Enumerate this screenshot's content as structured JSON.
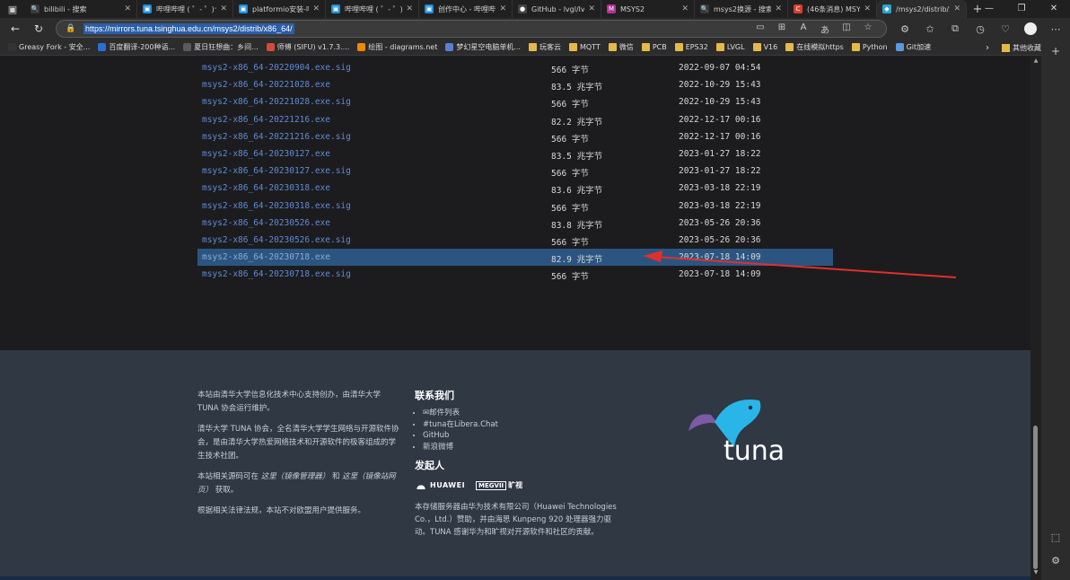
{
  "tabs": [
    {
      "label": "bilibili - 搜索",
      "icon": "search-icon",
      "color": "#3a3a3a",
      "glyph": "🔍"
    },
    {
      "label": "哔哩哔哩 ( ゜- ゜)つ",
      "icon": "bilibili-icon",
      "color": "#1f8ee0",
      "glyph": "▣"
    },
    {
      "label": "platformio安装-哔哩",
      "icon": "bilibili-icon",
      "color": "#1f8ee0",
      "glyph": "▣"
    },
    {
      "label": "哔哩哔哩 ( ゜- ゜)つ",
      "icon": "bilibili-icon",
      "color": "#1f8ee0",
      "glyph": "▣"
    },
    {
      "label": "创作中心 - 哔哩哔哩",
      "icon": "bilibili-icon",
      "color": "#1f8ee0",
      "glyph": "▣"
    },
    {
      "label": "GitHub - lvgl/lv_pla",
      "icon": "github-icon",
      "color": "#444444",
      "glyph": "●"
    },
    {
      "label": "MSYS2",
      "icon": "msys2-icon",
      "color": "#b4329a",
      "glyph": "M"
    },
    {
      "label": "msys2换源 - 搜索",
      "icon": "search-icon",
      "color": "#3a3a3a",
      "glyph": "🔍"
    },
    {
      "label": "(46条消息) MSYS2",
      "icon": "csdn-icon",
      "color": "#d9402b",
      "glyph": "C"
    },
    {
      "label": "/msys2/distrib/x86",
      "icon": "tuna-icon",
      "color": "#2ea3d8",
      "glyph": "◆"
    }
  ],
  "address": {
    "url": "https://mirrors.tuna.tsinghua.edu.cn/msys2/distrib/x86_64/"
  },
  "bookmarks": [
    {
      "label": "Greasy Fork - 安全...",
      "icon": "greasyfork-icon",
      "color": "#333333"
    },
    {
      "label": "百度翻译-200种语...",
      "icon": "baidu-translate-icon",
      "color": "#2a6ed8"
    },
    {
      "label": "夏日狂想曲：乡间...",
      "icon": "wordpress-icon",
      "color": "#5a5a5a"
    },
    {
      "label": "师傅 (SIFU) v1.7.3....",
      "icon": "site-icon",
      "color": "#d14b3a"
    },
    {
      "label": "绘图 - diagrams.net",
      "icon": "drawio-icon",
      "color": "#f08705"
    },
    {
      "label": "梦幻星空电脑单机...",
      "icon": "site-icon",
      "color": "#5b7fd1"
    },
    {
      "label": "玩客云",
      "icon": "folder-icon",
      "color": "#e6b84a"
    },
    {
      "label": "MQTT",
      "icon": "folder-icon",
      "color": "#e6b84a"
    },
    {
      "label": "微信",
      "icon": "folder-icon",
      "color": "#e6b84a"
    },
    {
      "label": "PCB",
      "icon": "folder-icon",
      "color": "#e6b84a"
    },
    {
      "label": "EPS32",
      "icon": "folder-icon",
      "color": "#e6b84a"
    },
    {
      "label": "LVGL",
      "icon": "folder-icon",
      "color": "#e6b84a"
    },
    {
      "label": "V16",
      "icon": "folder-icon",
      "color": "#e6b84a"
    },
    {
      "label": "在线模拟https",
      "icon": "folder-icon",
      "color": "#e6b84a"
    },
    {
      "label": "Python",
      "icon": "folder-icon",
      "color": "#e6b84a"
    },
    {
      "label": "Git加速",
      "icon": "git-icon",
      "color": "#5a9ae0"
    }
  ],
  "bookmarks_other": "其他收藏夹",
  "files": [
    {
      "name": "msys2-x86_64-20220904.exe.sig",
      "size": "566 字节",
      "date": "2022-09-07 04:54"
    },
    {
      "name": "msys2-x86_64-20221028.exe",
      "size": "83.5 兆字节",
      "date": "2022-10-29 15:43"
    },
    {
      "name": "msys2-x86_64-20221028.exe.sig",
      "size": "566 字节",
      "date": "2022-10-29 15:43"
    },
    {
      "name": "msys2-x86_64-20221216.exe",
      "size": "82.2 兆字节",
      "date": "2022-12-17 00:16"
    },
    {
      "name": "msys2-x86_64-20221216.exe.sig",
      "size": "566 字节",
      "date": "2022-12-17 00:16"
    },
    {
      "name": "msys2-x86_64-20230127.exe",
      "size": "83.5 兆字节",
      "date": "2023-01-27 18:22"
    },
    {
      "name": "msys2-x86_64-20230127.exe.sig",
      "size": "566 字节",
      "date": "2023-01-27 18:22"
    },
    {
      "name": "msys2-x86_64-20230318.exe",
      "size": "83.6 兆字节",
      "date": "2023-03-18 22:19"
    },
    {
      "name": "msys2-x86_64-20230318.exe.sig",
      "size": "566 字节",
      "date": "2023-03-18 22:19"
    },
    {
      "name": "msys2-x86_64-20230526.exe",
      "size": "83.8 兆字节",
      "date": "2023-05-26 20:36"
    },
    {
      "name": "msys2-x86_64-20230526.exe.sig",
      "size": "566 字节",
      "date": "2023-05-26 20:36"
    },
    {
      "name": "msys2-x86_64-20230718.exe",
      "size": "82.9 兆字节",
      "date": "2023-07-18 14:09",
      "selected": true
    },
    {
      "name": "msys2-x86_64-20230718.exe.sig",
      "size": "566 字节",
      "date": "2023-07-18 14:09"
    }
  ],
  "annotation": {
    "color": "#e0302c"
  },
  "footer": {
    "about": {
      "p1": "本站由清华大学信息化技术中心支持创办，由清华大学 TUNA 协会运行维护。",
      "p2": "清华大学 TUNA 协会，全名清华大学学生网络与开源软件协会，是由清华大学热爱网络技术和开源软件的极客组成的学生技术社团。",
      "p3_pre": "本站相关源码可在",
      "p3_link1": "这里（镜像管理器）",
      "p3_mid": "和",
      "p3_link2": "这里（镜像站网页）",
      "p3_post": "获取。",
      "p4": "根据相关法律法规，本站不对欧盟用户提供服务。"
    },
    "contact_title": "联系我们",
    "contact_items": [
      "✉邮件列表",
      "#tuna在Libera.Chat",
      "GitHub",
      "新浪微博"
    ],
    "sponsor_title": "发起人",
    "sponsor_huawei": "HUAWEI",
    "sponsor_megvii_box": "MEGVII",
    "sponsor_megvii_text": "旷视",
    "sponsor_desc": "本存储服务器由华为技术有限公司（Huawei Technologies Co.，Ltd.）赞助，并由海思 Kunpeng 920 处理器强力驱动。TUNA 感谢华为和旷视对开源软件和社区的贡献。",
    "logo_text": "tuna",
    "logo_colors": {
      "fish": "#29b5e8",
      "fin": "#7b5aa6",
      "text": "#ffffff"
    }
  }
}
